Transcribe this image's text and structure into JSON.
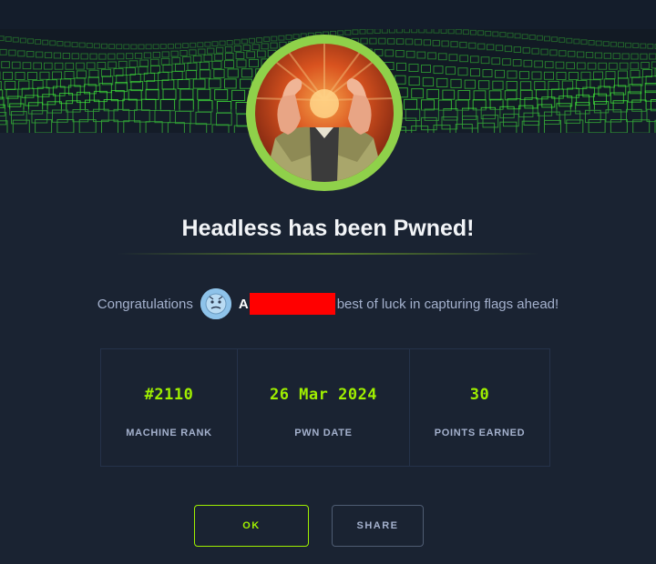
{
  "colors": {
    "background": "#1a2332",
    "accent_green": "#9fef00",
    "muted_text": "#a4b1cd",
    "redaction": "#ff0000"
  },
  "banner": {
    "decoration": "green-wireframe-cube-wave"
  },
  "machine_avatar": {
    "icon": "machine-avatar-icon"
  },
  "title": "Headless has been Pwned!",
  "congrats": {
    "prefix": "Congratulations",
    "user_avatar_icon": "user-avatar-icon",
    "user_initial": "A",
    "suffix": "best of luck in capturing flags ahead!"
  },
  "stats": [
    {
      "value": "#2110",
      "label": "MACHINE RANK"
    },
    {
      "value": "26 Mar 2024",
      "label": "PWN DATE"
    },
    {
      "value": "30",
      "label": "POINTS EARNED"
    }
  ],
  "buttons": {
    "ok_label": "OK",
    "share_label": "SHARE"
  }
}
